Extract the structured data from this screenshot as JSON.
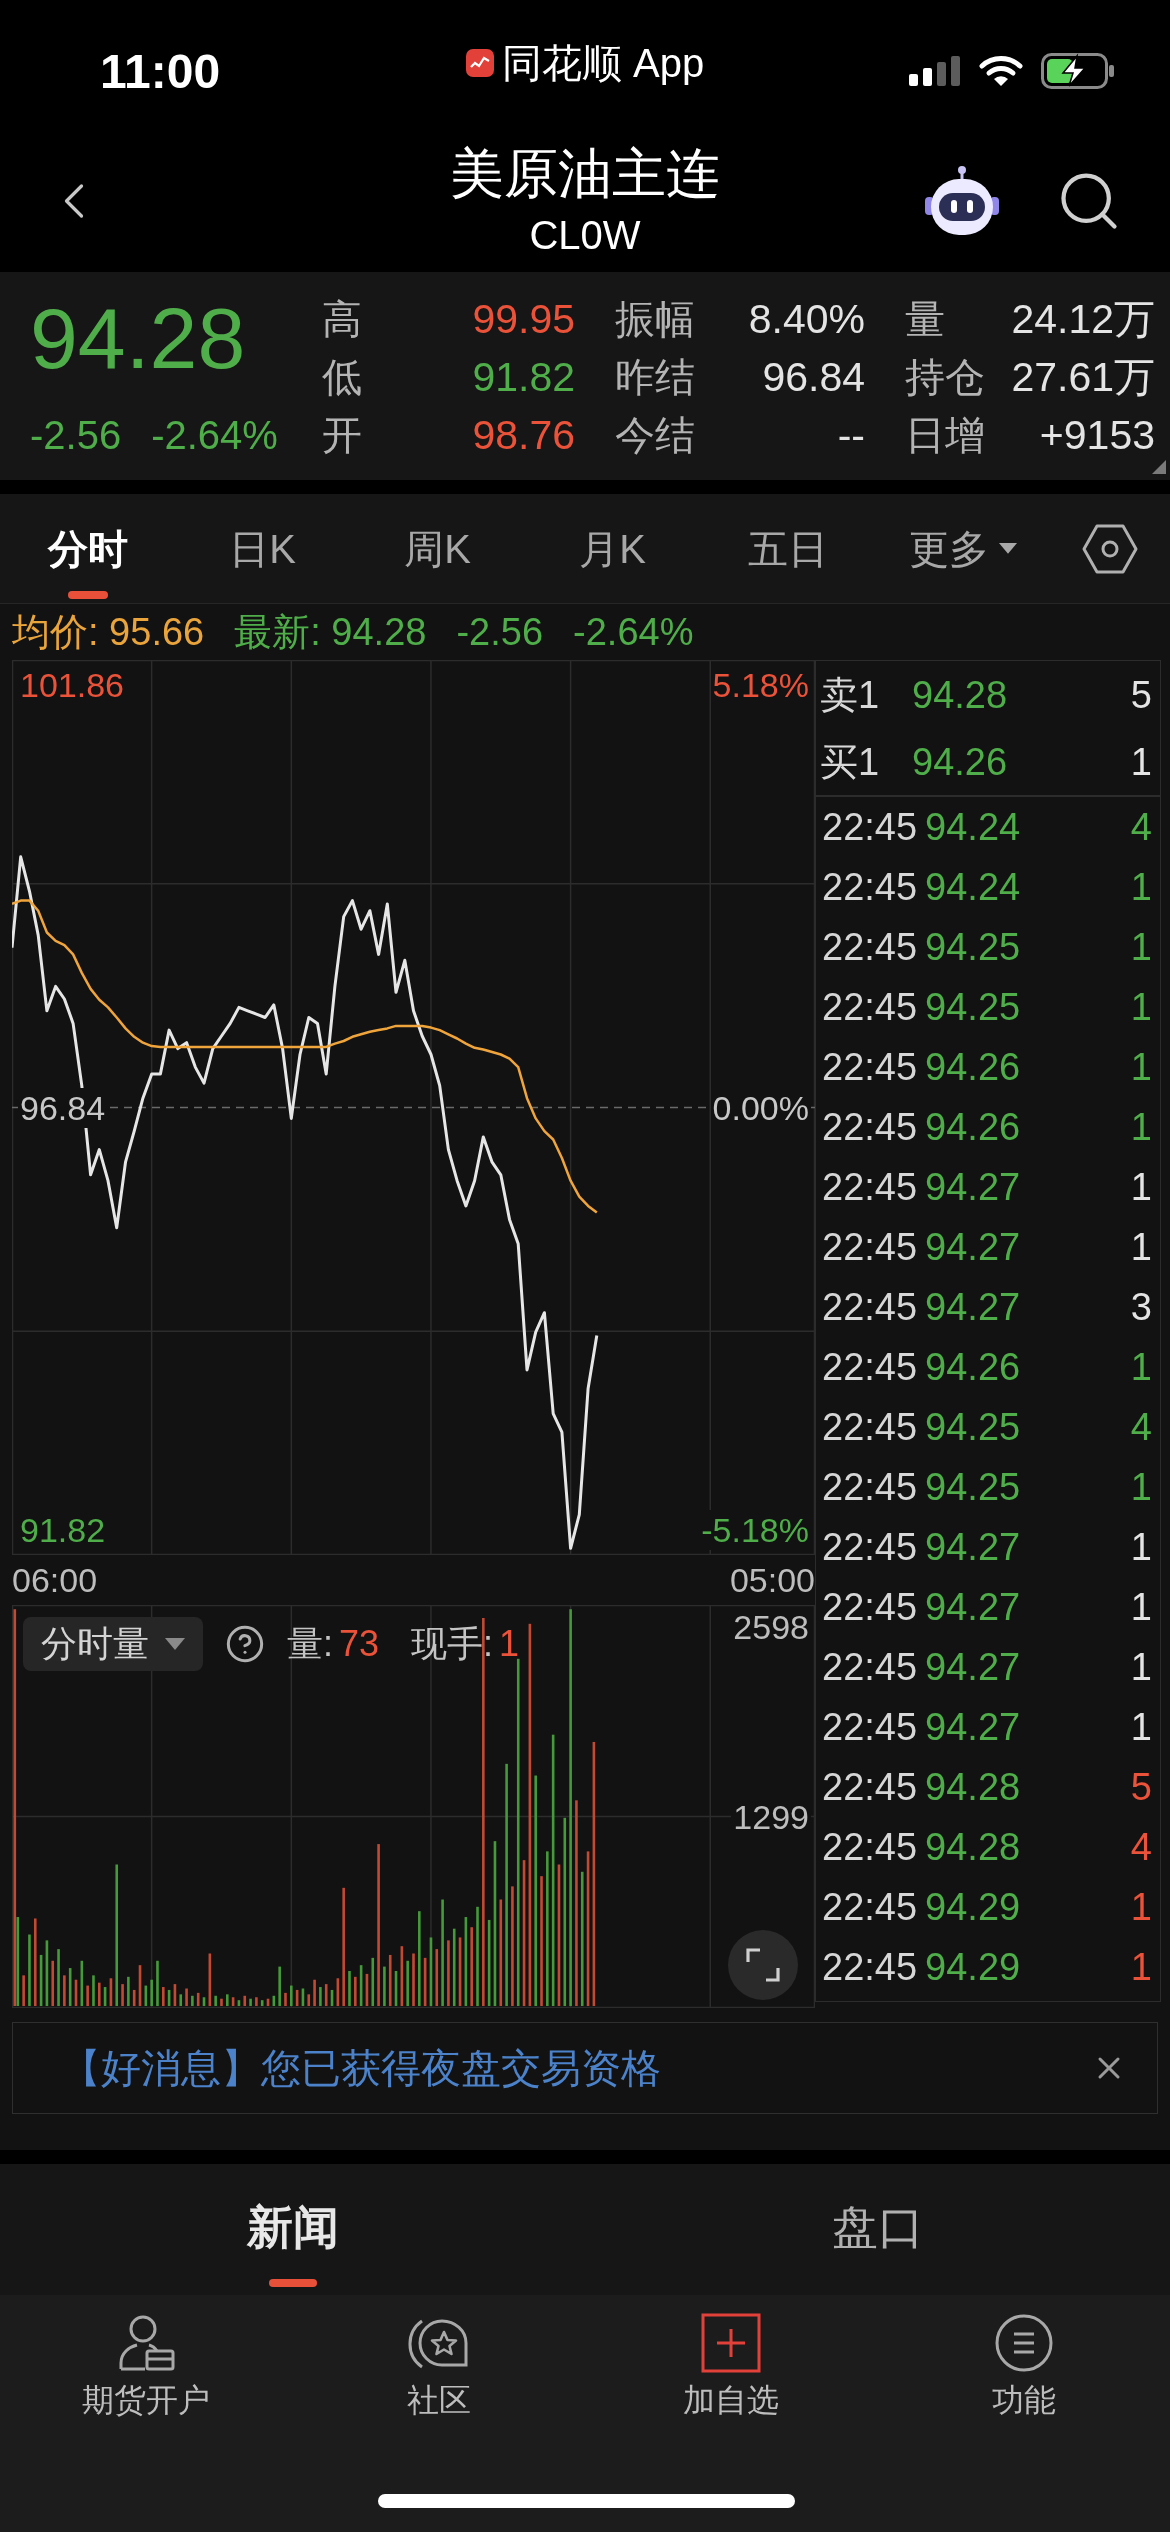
{
  "status_bar": {
    "time": "11:00",
    "back_app": "同花顺 App"
  },
  "header": {
    "title": "美原油主连",
    "subtitle": "CL0W"
  },
  "quote": {
    "price": "94.28",
    "change": "-2.56",
    "change_pct": "-2.64%",
    "color": "#4fae4a",
    "stats": [
      {
        "label": "高",
        "value": "99.95",
        "color": "#ea5339"
      },
      {
        "label": "振幅",
        "value": "8.40%",
        "color": "#e4e4e4"
      },
      {
        "label": "量",
        "value": "24.12万",
        "color": "#e4e4e4"
      },
      {
        "label": "低",
        "value": "91.82",
        "color": "#4fae4a"
      },
      {
        "label": "昨结",
        "value": "96.84",
        "color": "#e4e4e4"
      },
      {
        "label": "持仓",
        "value": "27.61万",
        "color": "#e4e4e4"
      },
      {
        "label": "开",
        "value": "98.76",
        "color": "#ea5339"
      },
      {
        "label": "今结",
        "value": "--",
        "color": "#e4e4e4"
      },
      {
        "label": "日增",
        "value": "+9153",
        "color": "#e4e4e4"
      }
    ]
  },
  "chart_tabs": [
    {
      "label": "分时",
      "selected": true,
      "dropdown": false
    },
    {
      "label": "日K",
      "selected": false,
      "dropdown": false
    },
    {
      "label": "周K",
      "selected": false,
      "dropdown": false
    },
    {
      "label": "月K",
      "selected": false,
      "dropdown": false
    },
    {
      "label": "五日",
      "selected": false,
      "dropdown": false
    },
    {
      "label": "更多",
      "selected": false,
      "dropdown": true
    }
  ],
  "summary": {
    "average": "均价: 95.66",
    "latest": "最新: 94.28",
    "change": "-2.56",
    "change_pct": "-2.64%"
  },
  "price_chart": {
    "percent_labels": [
      "5.18%",
      "0.00%",
      "-5.18%"
    ],
    "chart_data": {
      "type": "line",
      "categories": [
        null,
        null,
        null,
        null,
        null,
        null,
        null,
        null,
        null,
        null,
        null,
        null,
        null,
        null,
        null,
        null,
        null,
        null,
        null,
        null,
        null,
        null,
        null,
        null,
        null,
        null,
        null,
        null,
        null,
        null,
        null,
        null,
        null,
        null,
        null,
        null,
        null,
        null,
        null,
        null,
        null,
        null,
        null,
        null,
        null,
        null,
        null,
        null,
        null,
        null,
        null,
        null,
        null,
        null,
        null,
        null,
        null,
        null,
        null,
        null,
        null,
        null,
        null,
        null,
        null,
        null,
        null,
        null,
        null,
        null,
        null,
        null,
        null,
        null,
        null,
        null,
        null,
        null,
        null,
        null,
        null,
        null,
        null,
        null,
        null,
        null,
        null,
        null,
        null,
        null,
        null,
        null,
        null
      ],
      "ylim": [
        91.52,
        102.16
      ],
      "yticks": [
        {
          "value": 101.86,
          "label": "101.86"
        },
        {
          "value": 96.84,
          "label": "96.84"
        },
        {
          "value": 91.82,
          "label": "91.82"
        }
      ],
      "grid": true,
      "ref_lines": [
        {
          "axis": "y",
          "value": 96.84
        }
      ],
      "series": [
        {
          "color": "#e6e6e6",
          "values": [
            98.74,
            99.82,
            99.41,
            98.89,
            97.99,
            98.28,
            98.13,
            97.84,
            97.1,
            96.04,
            96.34,
            95.97,
            95.41,
            96.19,
            96.56,
            96.95,
            97.24,
            97.24,
            97.76,
            97.54,
            97.61,
            97.32,
            97.13,
            97.54,
            97.69,
            97.84,
            98.03,
            97.99,
            97.95,
            97.91,
            98.06,
            97.54,
            96.71,
            97.47,
            97.91,
            97.84,
            97.24,
            98.28,
            99.11,
            99.3,
            98.96,
            99.18,
            98.66,
            99.26,
            98.21,
            98.59,
            97.99,
            97.69,
            97.47,
            97.1,
            96.34,
            95.97,
            95.67,
            95.97,
            96.49,
            96.19,
            96.04,
            95.51,
            95.22,
            93.72,
            94.17,
            94.4,
            93.2,
            92.98,
            91.6,
            92.0,
            93.5,
            94.13,
            null,
            null,
            null,
            null,
            null,
            null,
            null,
            null,
            null,
            null,
            null,
            null,
            null,
            null,
            null,
            null,
            null,
            null,
            null,
            null,
            null,
            null,
            null,
            null,
            null
          ]
        },
        {
          "color": "#f0a53c",
          "values": [
            99.26,
            99.3,
            99.3,
            99.18,
            98.92,
            98.82,
            98.77,
            98.66,
            98.44,
            98.25,
            98.12,
            98.03,
            97.91,
            97.78,
            97.68,
            97.61,
            97.57,
            97.56,
            97.56,
            97.56,
            97.56,
            97.56,
            97.56,
            97.56,
            97.56,
            97.56,
            97.56,
            97.56,
            97.56,
            97.56,
            97.56,
            97.56,
            97.56,
            97.56,
            97.56,
            97.56,
            97.56,
            97.6,
            97.63,
            97.68,
            97.71,
            97.74,
            97.76,
            97.78,
            97.81,
            97.81,
            97.81,
            97.81,
            97.79,
            97.76,
            97.71,
            97.66,
            97.6,
            97.55,
            97.53,
            97.5,
            97.47,
            97.42,
            97.32,
            96.95,
            96.71,
            96.56,
            96.46,
            96.24,
            95.97,
            95.78,
            95.67,
            95.59,
            null,
            null,
            null,
            null,
            null,
            null,
            null,
            null,
            null,
            null,
            null,
            null,
            null,
            null,
            null,
            null,
            null,
            null,
            null,
            null,
            null,
            null,
            null,
            null,
            null
          ]
        }
      ]
    },
    "time_labels": [
      "06:00",
      "05:00"
    ]
  },
  "volume_chart": {
    "selector": "分时量",
    "stats": [
      {
        "label": "量:",
        "value": "73"
      },
      {
        "label": "现手:",
        "value": "1"
      }
    ],
    "chart_data": {
      "type": "bar",
      "categories": [
        null,
        null,
        null,
        null,
        null,
        null,
        null,
        null,
        null,
        null,
        null,
        null,
        null,
        null,
        null,
        null,
        null,
        null,
        null,
        null,
        null,
        null,
        null,
        null,
        null,
        null,
        null,
        null,
        null,
        null,
        null,
        null,
        null,
        null,
        null,
        null,
        null,
        null,
        null,
        null,
        null,
        null,
        null,
        null,
        null,
        null,
        null,
        null,
        null,
        null,
        null,
        null,
        null,
        null,
        null,
        null,
        null,
        null,
        null,
        null,
        null,
        null,
        null,
        null,
        null,
        null,
        null,
        null,
        null,
        null,
        null,
        null,
        null,
        null,
        null,
        null,
        null,
        null,
        null,
        null,
        null,
        null,
        null,
        null,
        null,
        null,
        null,
        null,
        null,
        null,
        null,
        null,
        null,
        null,
        null,
        null,
        null,
        null,
        null,
        null,
        null,
        null,
        null,
        null,
        null,
        null,
        null,
        null,
        null,
        null,
        null,
        null,
        null,
        null,
        null,
        null,
        null,
        null,
        null,
        null,
        null,
        null,
        null,
        null,
        null,
        null,
        null,
        null,
        null,
        null,
        null,
        null,
        null,
        null,
        null,
        null,
        null,
        null,
        null
      ],
      "ylim": [
        0,
        2749
      ],
      "yticks": [
        {
          "value": 2598,
          "label": "2598"
        },
        {
          "value": 1299,
          "label": "1299"
        }
      ],
      "grid": true,
      "series": [
        {
          "values": [
            2720,
            610,
            210,
            490,
            600,
            350,
            450,
            310,
            390,
            210,
            260,
            180,
            310,
            140,
            210,
            160,
            130,
            190,
            970,
            150,
            200,
            110,
            280,
            140,
            180,
            310,
            130,
            110,
            150,
            80,
            120,
            70,
            90,
            60,
            360,
            70,
            50,
            80,
            60,
            40,
            70,
            50,
            60,
            40,
            50,
            70,
            270,
            90,
            140,
            110,
            120,
            80,
            180,
            130,
            150,
            110,
            190,
            810,
            240,
            200,
            280,
            220,
            330,
            1110,
            270,
            350,
            240,
            410,
            310,
            360,
            650,
            330,
            470,
            390,
            730,
            450,
            530,
            470,
            610,
            540,
            680,
            2660,
            590,
            1130,
            730,
            1660,
            820,
            2380,
            1000,
            2620,
            1580,
            890,
            1060,
            1860,
            970,
            1290,
            2720,
            1410,
            920,
            1060,
            1810,
            null,
            null,
            null,
            null,
            null,
            null,
            null,
            null,
            null,
            null,
            null,
            null,
            null,
            null,
            null,
            null,
            null,
            null,
            null,
            null,
            null,
            null,
            null,
            null,
            null,
            null,
            null,
            null,
            null,
            null,
            null,
            null,
            null,
            null,
            null,
            null,
            null,
            null
          ],
          "colors": [
            "#c24a33",
            "#459a3a",
            "#c24a33",
            "#459a3a",
            "#c24a33",
            "#459a3a",
            "#459a3a",
            "#c24a33",
            "#459a3a",
            "#c24a33",
            "#459a3a",
            "#c24a33",
            "#459a3a",
            "#c24a33",
            "#459a3a",
            "#c24a33",
            "#459a3a",
            "#c24a33",
            "#459a3a",
            "#c24a33",
            "#459a3a",
            "#c24a33",
            "#c24a33",
            "#459a3a",
            "#459a3a",
            "#459a3a",
            "#c24a33",
            "#459a3a",
            "#c24a33",
            "#459a3a",
            "#c24a33",
            "#459a3a",
            "#c24a33",
            "#459a3a",
            "#c24a33",
            "#459a3a",
            "#c24a33",
            "#459a3a",
            "#c24a33",
            "#459a3a",
            "#c24a33",
            "#459a3a",
            "#c24a33",
            "#459a3a",
            "#c24a33",
            "#459a3a",
            "#459a3a",
            "#c24a33",
            "#459a3a",
            "#c24a33",
            "#459a3a",
            "#c24a33",
            "#c24a33",
            "#459a3a",
            "#c24a33",
            "#459a3a",
            "#c24a33",
            "#c24a33",
            "#459a3a",
            "#c24a33",
            "#459a3a",
            "#c24a33",
            "#459a3a",
            "#c24a33",
            "#459a3a",
            "#c24a33",
            "#459a3a",
            "#c24a33",
            "#459a3a",
            "#c24a33",
            "#459a3a",
            "#c24a33",
            "#459a3a",
            "#c24a33",
            "#459a3a",
            "#c24a33",
            "#459a3a",
            "#c24a33",
            "#459a3a",
            "#c24a33",
            "#459a3a",
            "#c24a33",
            "#459a3a",
            "#459a3a",
            "#c24a33",
            "#459a3a",
            "#c24a33",
            "#459a3a",
            "#c24a33",
            "#c24a33",
            "#459a3a",
            "#c24a33",
            "#459a3a",
            "#459a3a",
            "#c24a33",
            "#459a3a",
            "#459a3a",
            "#c24a33",
            "#459a3a",
            "#c24a33",
            "#c24a33",
            null,
            null,
            null,
            null,
            null,
            null,
            null,
            null,
            null,
            null,
            null,
            null,
            null,
            null,
            null,
            null,
            null,
            null,
            null,
            null,
            null,
            null,
            null,
            null,
            null,
            null,
            null,
            null,
            null,
            null,
            null,
            null,
            null,
            null,
            null,
            null,
            null,
            null
          ]
        }
      ]
    }
  },
  "order_book": [
    {
      "label": "卖1",
      "price": "94.28",
      "volume": "5"
    },
    {
      "label": "买1",
      "price": "94.26",
      "volume": "1"
    }
  ],
  "trades": [
    {
      "time": "22:45",
      "price": "94.24",
      "volume": "4",
      "color": "#4fae4a"
    },
    {
      "time": "22:45",
      "price": "94.24",
      "volume": "1",
      "color": "#4fae4a"
    },
    {
      "time": "22:45",
      "price": "94.25",
      "volume": "1",
      "color": "#4fae4a"
    },
    {
      "time": "22:45",
      "price": "94.25",
      "volume": "1",
      "color": "#4fae4a"
    },
    {
      "time": "22:45",
      "price": "94.26",
      "volume": "1",
      "color": "#4fae4a"
    },
    {
      "time": "22:45",
      "price": "94.26",
      "volume": "1",
      "color": "#4fae4a"
    },
    {
      "time": "22:45",
      "price": "94.27",
      "volume": "1",
      "color": "#e4e4e4"
    },
    {
      "time": "22:45",
      "price": "94.27",
      "volume": "1",
      "color": "#e4e4e4"
    },
    {
      "time": "22:45",
      "price": "94.27",
      "volume": "3",
      "color": "#e4e4e4"
    },
    {
      "time": "22:45",
      "price": "94.26",
      "volume": "1",
      "color": "#4fae4a"
    },
    {
      "time": "22:45",
      "price": "94.25",
      "volume": "4",
      "color": "#4fae4a"
    },
    {
      "time": "22:45",
      "price": "94.25",
      "volume": "1",
      "color": "#4fae4a"
    },
    {
      "time": "22:45",
      "price": "94.27",
      "volume": "1",
      "color": "#e4e4e4"
    },
    {
      "time": "22:45",
      "price": "94.27",
      "volume": "1",
      "color": "#e4e4e4"
    },
    {
      "time": "22:45",
      "price": "94.27",
      "volume": "1",
      "color": "#e4e4e4"
    },
    {
      "time": "22:45",
      "price": "94.27",
      "volume": "1",
      "color": "#e4e4e4"
    },
    {
      "time": "22:45",
      "price": "94.28",
      "volume": "5",
      "color": "#ea5339"
    },
    {
      "time": "22:45",
      "price": "94.28",
      "volume": "4",
      "color": "#ea5339"
    },
    {
      "time": "22:45",
      "price": "94.29",
      "volume": "1",
      "color": "#ea5339"
    },
    {
      "time": "22:45",
      "price": "94.29",
      "volume": "1",
      "color": "#ea5339"
    }
  ],
  "notice": {
    "text": "【好消息】您已获得夜盘交易资格"
  },
  "bottom_tabs": [
    {
      "label": "新闻",
      "selected": true
    },
    {
      "label": "盘口",
      "selected": false
    }
  ],
  "nav": [
    {
      "label": "期货开户"
    },
    {
      "label": "社区"
    },
    {
      "label": "加自选"
    },
    {
      "label": "功能"
    }
  ]
}
